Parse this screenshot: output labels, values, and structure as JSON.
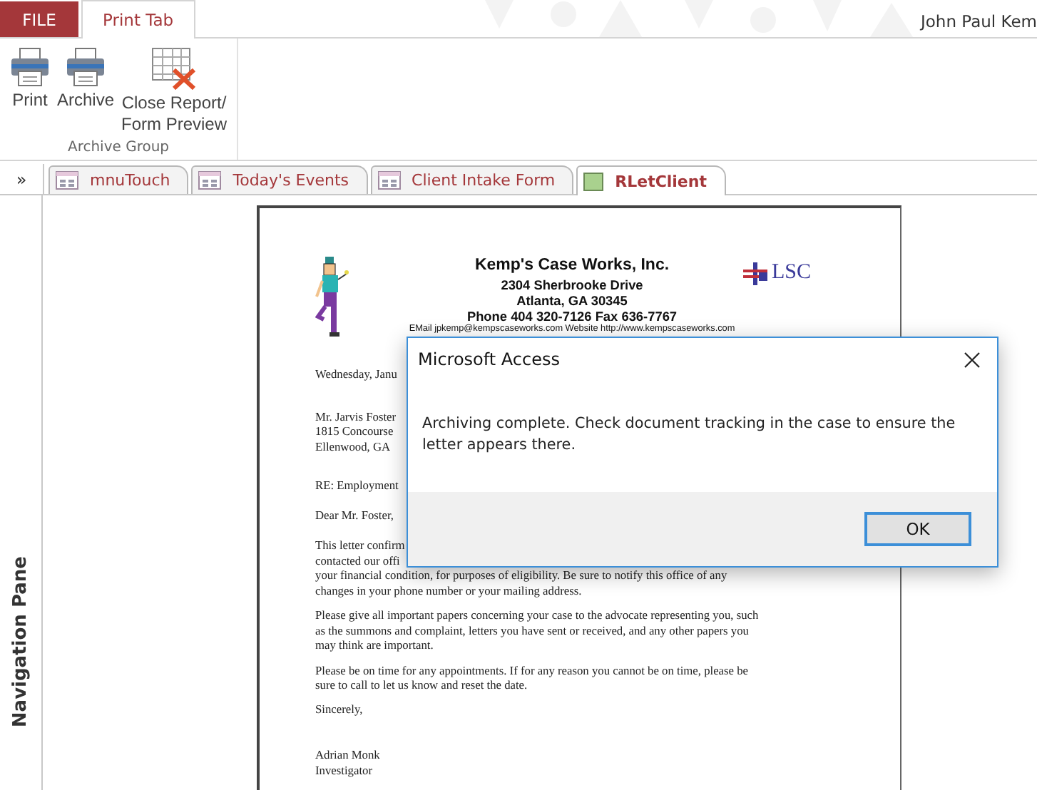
{
  "ribbon": {
    "tabs": [
      {
        "label": "FILE",
        "kind": "file",
        "selected": false
      },
      {
        "label": "Print Tab",
        "kind": "tab",
        "selected": true
      }
    ],
    "user": "John Paul Kem",
    "buttons": [
      {
        "label": "Print"
      },
      {
        "label": "Archive"
      },
      {
        "label": "Close Report/ Form Preview"
      }
    ],
    "group": "Archive Group"
  },
  "nav_pane": {
    "toggle": "»",
    "title": "Navigation Pane"
  },
  "document_tabs": [
    {
      "label": "mnuTouch",
      "kind": "form",
      "selected": false
    },
    {
      "label": "Today's Events",
      "kind": "form",
      "selected": false
    },
    {
      "label": "Client Intake Form",
      "kind": "form",
      "selected": false
    },
    {
      "label": "RLetClient",
      "kind": "report",
      "selected": true
    }
  ],
  "report": {
    "company": "Kemp's Case Works, Inc.",
    "address_lines": [
      "2304 Sherbrooke Drive",
      "Atlanta, GA 30345",
      "Phone 404 320-7126  Fax 636-7767"
    ],
    "contact": "EMail jpkemp@kempscaseworks.com  Website http://www.kempscaseworks.com",
    "logo_text": "LSC",
    "date": "Wednesday, Janu",
    "recipient_lines": [
      "Mr. Jarvis Foster",
      "1815 Concourse",
      "Ellenwood, GA"
    ],
    "re": "RE: Employment",
    "salutation": "Dear Mr. Foster,",
    "paragraphs": [
      [
        "This letter confirm",
        "contacted our offi",
        "your financial condition, for purposes of eligibility. Be sure to notify this office of any",
        "changes in your phone number or your mailing address."
      ],
      [
        "Please give all important papers concerning your case to the advocate representing you, such",
        "as the summons and complaint, letters you have sent or received, and any other papers you",
        "may think are important."
      ],
      [
        "Please be on time for any appointments.  If for any reason you cannot be on time, please be",
        "sure to call  to let us know and reset the date."
      ]
    ],
    "closing": "Sincerely,",
    "signer_name": "Adrian Monk",
    "signer_title": "Investigator"
  },
  "dialog": {
    "title": "Microsoft Access",
    "message": "Archiving complete.  Check document tracking in the case to ensure the letter appears there.",
    "button": "OK"
  }
}
